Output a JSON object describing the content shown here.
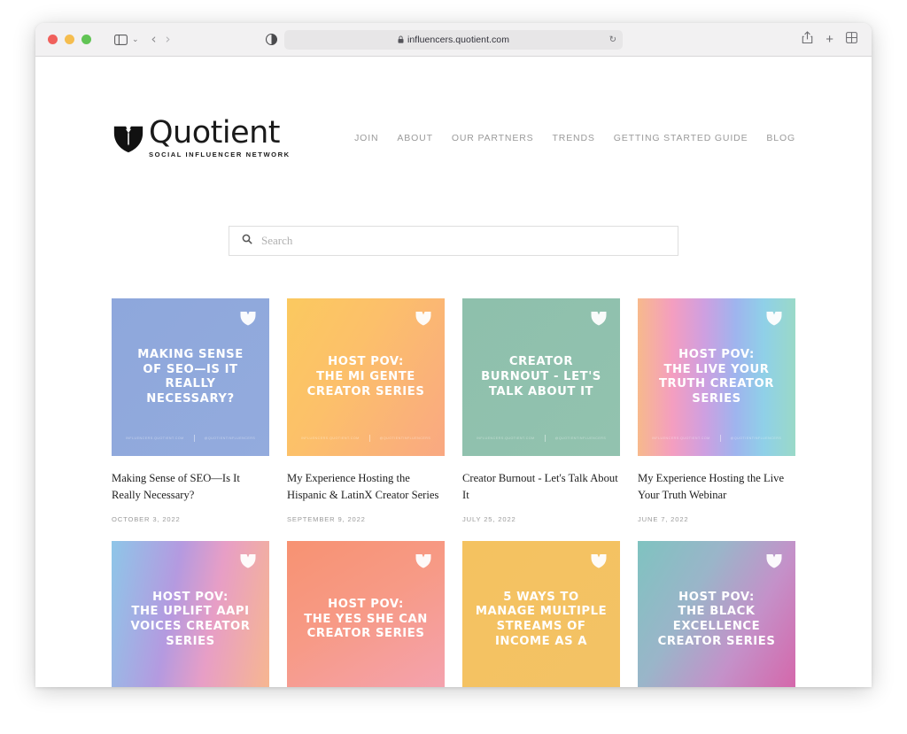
{
  "browser": {
    "url": "influencers.quotient.com",
    "lock_icon": "lock-icon",
    "reload_icon": "reload-icon",
    "sidebar_icon": "sidebar-icon",
    "back_icon": "chevron-left-icon",
    "forward_icon": "chevron-right-icon",
    "privacy_icon": "privacy-shield-icon",
    "share_icon": "share-icon",
    "newtab_icon": "plus-icon",
    "tabs_icon": "tab-overview-icon",
    "back_glyph": "‹",
    "forward_glyph": "›",
    "chevron_glyph": "⌄",
    "reload_glyph": "↻",
    "plus_glyph": "+"
  },
  "site": {
    "logo_word": "Quotient",
    "logo_tagline": "SOCIAL INFLUENCER NETWORK",
    "nav": [
      {
        "label": "JOIN"
      },
      {
        "label": "ABOUT"
      },
      {
        "label": "OUR PARTNERS"
      },
      {
        "label": "TRENDS"
      },
      {
        "label": "GETTING STARTED GUIDE"
      },
      {
        "label": "BLOG"
      }
    ]
  },
  "search": {
    "placeholder": "Search",
    "value": "",
    "icon": "search-icon"
  },
  "posts": [
    {
      "thumb_title": "MAKING SENSE\nOF SEO—IS IT\nREALLY\nNECESSARY?",
      "title": "Making Sense of SEO—Is It Really Necessary?",
      "date": "OCTOBER 3, 2022",
      "bg": "linear-gradient(135deg, #8ea7dc 0%, #93abdd 100%)"
    },
    {
      "thumb_title": "HOST POV:\nTHE MI GENTE\nCREATOR SERIES",
      "title": "My Experience Hosting the Hispanic & LatinX Creator Series",
      "date": "SEPTEMBER 9, 2022",
      "bg": "linear-gradient(120deg, #fbc95f 0%, #fcc06a 40%, #f9a882 100%)"
    },
    {
      "thumb_title": "CREATOR\nBURNOUT - LET'S\nTALK ABOUT IT",
      "title": "Creator Burnout - Let's Talk About It",
      "date": "JULY 25, 2022",
      "bg": "linear-gradient(135deg, #8ec0ac 0%, #92c2af 100%)"
    },
    {
      "thumb_title": "HOST POV:\nTHE LIVE YOUR\nTRUTH CREATOR\nSERIES",
      "title": "My Experience Hosting the Live Your Truth Webinar",
      "date": "JUNE 7, 2022",
      "bg": "linear-gradient(90deg, #f7b98c 0%, #f49ec0 22%, #cf9fe0 42%, #9fb4ee 62%, #8fd0e8 80%, #9ad9c8 100%)"
    },
    {
      "thumb_title": "HOST POV:\nTHE UPLIFT AAPI\nVOICES CREATOR\nSERIES",
      "title": "",
      "date": "",
      "bg": "linear-gradient(100deg, #8ec6e8 0%, #b49ae0 38%, #e79ec6 62%, #f7b78f 100%)"
    },
    {
      "thumb_title": "HOST POV:\nTHE YES SHE CAN\nCREATOR SERIES",
      "title": "",
      "date": "",
      "bg": "linear-gradient(150deg, #f79272 0%, #f79a86 45%, #f4a3b2 100%)"
    },
    {
      "thumb_title": "5 WAYS TO\nMANAGE MULTIPLE\nSTREAMS OF\nINCOME AS A",
      "title": "",
      "date": "",
      "bg": "linear-gradient(135deg, #f4c260 0%, #f3c265 100%)"
    },
    {
      "thumb_title": "HOST POV:\nTHE BLACK\nEXCELLENCE\nCREATOR SERIES",
      "title": "",
      "date": "",
      "bg": "linear-gradient(120deg, #7fc3c0 0%, #9ab5c9 35%, #c491c9 65%, #d664a8 100%)"
    }
  ],
  "thumb_footer": {
    "left": "INFLUENCERS.QUOTIENT.COM",
    "right": "@QUOTIENTINFLUENCERS"
  }
}
